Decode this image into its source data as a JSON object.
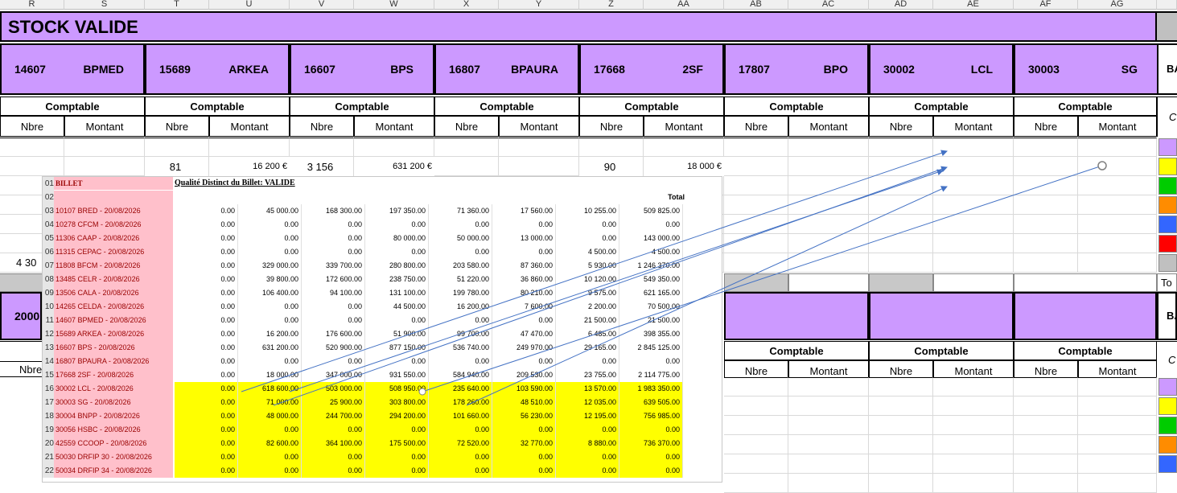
{
  "columns": [
    "R",
    "S",
    "T",
    "U",
    "V",
    "W",
    "X",
    "Y",
    "Z",
    "AA",
    "AB",
    "AC",
    "AD",
    "AE",
    "AF",
    "AG"
  ],
  "title": "STOCK VALIDE",
  "banks": [
    {
      "code": "14607",
      "name": "BPMED"
    },
    {
      "code": "15689",
      "name": "ARKEA"
    },
    {
      "code": "16607",
      "name": "BPS"
    },
    {
      "code": "16807",
      "name": "BPAURA"
    },
    {
      "code": "17668",
      "name": "2SF"
    },
    {
      "code": "17807",
      "name": "BPO"
    },
    {
      "code": "30002",
      "name": "LCL"
    },
    {
      "code": "30003",
      "name": "SG"
    }
  ],
  "right_fragments": {
    "bank_hdr": "BA",
    "comptable_hdr": "C",
    "total": "To",
    "bank_hdr2": "BA",
    "comptable_hdr2": "C"
  },
  "labels": {
    "comptable": "Comptable",
    "nbre": "Nbre",
    "montant": "Montant"
  },
  "totals_row": [
    {
      "nbre": "81",
      "montant": "16 200 €"
    },
    {
      "nbre": "3 156",
      "montant": "631 200 €"
    },
    {
      "nbre": "90",
      "montant": "18 000 €"
    }
  ],
  "left_fragments": {
    "value": "4 30",
    "bank": "2000",
    "nbre": "Nbre"
  },
  "colors": {
    "purple": "#cc99ff",
    "yellow": "#ffff00",
    "pink": "#ffc0cb",
    "arrow": "#4472c4"
  },
  "side_swatches": [
    "#cc99ff",
    "#ffff00",
    "#00cc00",
    "#ff8c00",
    "#3366ff",
    "#ff0000",
    "#c0c0c0"
  ],
  "side_swatches_lower": [
    "#cc99ff",
    "#ffff00",
    "#00cc00",
    "#ff8c00",
    "#3366ff"
  ],
  "embedded": {
    "billet": "BILLET",
    "quality": "Qualité Distinct du Billet:  VALIDE",
    "total_label": "Total",
    "row_numbers": [
      "01",
      "02",
      "03",
      "04",
      "05",
      "06",
      "07",
      "08",
      "09",
      "10",
      "11",
      "12",
      "13",
      "14",
      "15",
      "16",
      "17",
      "18",
      "19",
      "20",
      "21",
      "22"
    ],
    "rows": [
      {
        "label": "10107 BRED - 20/08/2026",
        "v": [
          "0.00",
          "45 000.00",
          "168 300.00",
          "197 350.00",
          "71 360.00",
          "17 560.00",
          "10 255.00",
          "509 825.00"
        ]
      },
      {
        "label": "10278 CFCM - 20/08/2026",
        "v": [
          "0.00",
          "0.00",
          "0.00",
          "0.00",
          "0.00",
          "0.00",
          "0.00",
          "0.00"
        ]
      },
      {
        "label": "11306 CAAP - 20/08/2026",
        "v": [
          "0.00",
          "0.00",
          "0.00",
          "80 000.00",
          "50 000.00",
          "13 000.00",
          "0.00",
          "143 000.00"
        ]
      },
      {
        "label": "11315 CEPAC - 20/08/2026",
        "v": [
          "0.00",
          "0.00",
          "0.00",
          "0.00",
          "0.00",
          "0.00",
          "4 500.00",
          "4 500.00"
        ]
      },
      {
        "label": "11808 BFCM - 20/08/2026",
        "v": [
          "0.00",
          "329 000.00",
          "339 700.00",
          "280 800.00",
          "203 580.00",
          "87 360.00",
          "5 930.00",
          "1 246 370.00"
        ]
      },
      {
        "label": "13485 CELR - 20/08/2026",
        "v": [
          "0.00",
          "39 800.00",
          "172 600.00",
          "238 750.00",
          "51 220.00",
          "36 860.00",
          "10 120.00",
          "549 350.00"
        ]
      },
      {
        "label": "13506 CALA - 20/08/2026",
        "v": [
          "0.00",
          "106 400.00",
          "94 100.00",
          "131 100.00",
          "199 780.00",
          "80 210.00",
          "9 575.00",
          "621 165.00"
        ]
      },
      {
        "label": "14265 CELDA - 20/08/2026",
        "v": [
          "0.00",
          "0.00",
          "0.00",
          "44 500.00",
          "16 200.00",
          "7 600.00",
          "2 200.00",
          "70 500.00"
        ]
      },
      {
        "label": "14607 BPMED - 20/08/2026",
        "v": [
          "0.00",
          "0.00",
          "0.00",
          "0.00",
          "0.00",
          "0.00",
          "21 500.00",
          "21 500.00"
        ]
      },
      {
        "label": "15689 ARKEA - 20/08/2026",
        "v": [
          "0.00",
          "16 200.00",
          "176 600.00",
          "51 900.00",
          "99 700.00",
          "47 470.00",
          "6 485.00",
          "398 355.00"
        ]
      },
      {
        "label": "16607 BPS - 20/08/2026",
        "v": [
          "0.00",
          "631 200.00",
          "520 900.00",
          "877 150.00",
          "536 740.00",
          "249 970.00",
          "29 165.00",
          "2 845 125.00"
        ]
      },
      {
        "label": "16807 BPAURA - 20/08/2026",
        "v": [
          "0.00",
          "0.00",
          "0.00",
          "0.00",
          "0.00",
          "0.00",
          "0.00",
          "0.00"
        ]
      },
      {
        "label": "17668 2SF - 20/08/2026",
        "v": [
          "0.00",
          "18 000.00",
          "347 000.00",
          "931 550.00",
          "584 940.00",
          "209 530.00",
          "23 755.00",
          "2 114 775.00"
        ]
      },
      {
        "label": "30002 LCL - 20/08/2026",
        "v": [
          "0.00",
          "618 600.00",
          "503 000.00",
          "508 950.00",
          "235 640.00",
          "103 590.00",
          "13 570.00",
          "1 983 350.00"
        ]
      },
      {
        "label": "30003 SG - 20/08/2026",
        "v": [
          "0.00",
          "71 000.00",
          "25 900.00",
          "303 800.00",
          "178 260.00",
          "48 510.00",
          "12 035.00",
          "639 505.00"
        ]
      },
      {
        "label": "30004 BNPP - 20/08/2026",
        "v": [
          "0.00",
          "48 000.00",
          "244 700.00",
          "294 200.00",
          "101 660.00",
          "56 230.00",
          "12 195.00",
          "756 985.00"
        ]
      },
      {
        "label": "30056 HSBC - 20/08/2026",
        "v": [
          "0.00",
          "0.00",
          "0.00",
          "0.00",
          "0.00",
          "0.00",
          "0.00",
          "0.00"
        ]
      },
      {
        "label": "42559 CCOOP - 20/08/2026",
        "v": [
          "0.00",
          "82 600.00",
          "364 100.00",
          "175 500.00",
          "72 520.00",
          "32 770.00",
          "8 880.00",
          "736 370.00"
        ]
      },
      {
        "label": "50030 DRFIP 30 - 20/08/2026",
        "v": [
          "0.00",
          "0.00",
          "0.00",
          "0.00",
          "0.00",
          "0.00",
          "0.00",
          "0.00"
        ]
      },
      {
        "label": "50034 DRFIP 34 - 20/08/2026",
        "v": [
          "0.00",
          "0.00",
          "0.00",
          "0.00",
          "0.00",
          "0.00",
          "0.00",
          "0.00"
        ]
      }
    ]
  }
}
